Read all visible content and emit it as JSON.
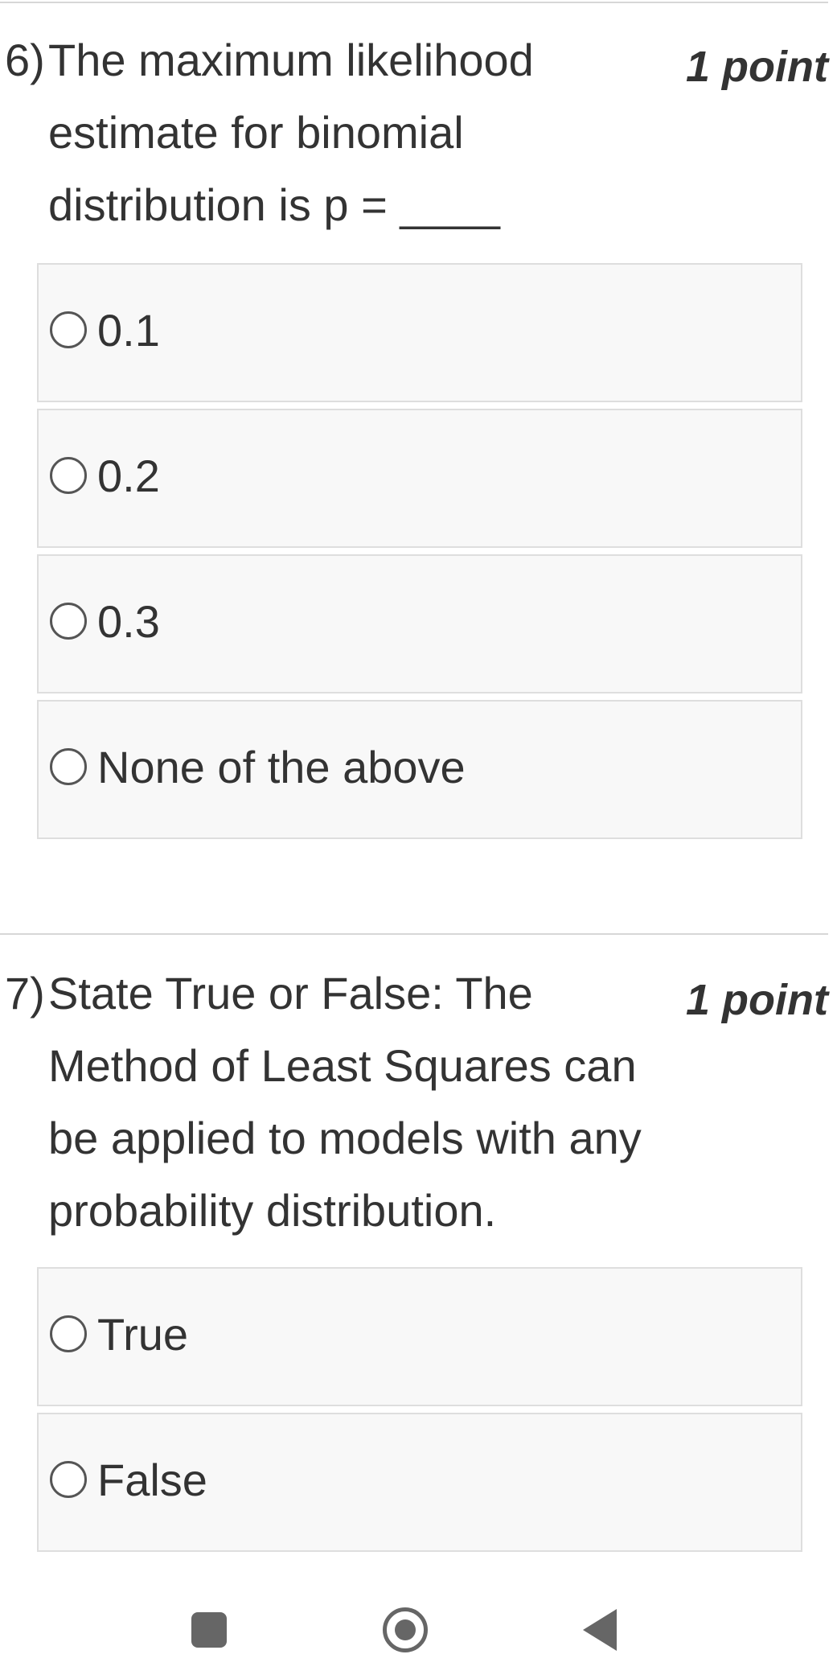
{
  "questions": [
    {
      "number": "6)",
      "text_lines": [
        "The maximum likelihood",
        "estimate for binomial",
        "distribution is p = ____"
      ],
      "points": "1 point",
      "options": [
        "0.1",
        "0.2",
        "0.3",
        "None of the above"
      ]
    },
    {
      "number": "7)",
      "text_lines": [
        "State True or False: The",
        "Method of Least Squares can",
        "be applied to models with any",
        "probability distribution."
      ],
      "points": "1 point",
      "options": [
        "True",
        "False"
      ]
    }
  ],
  "nav": {
    "recents_icon": "square-icon",
    "home_icon": "home-circle-icon",
    "back_icon": "triangle-back-icon"
  },
  "colors": {
    "text": "#333333",
    "option_bg": "#f8f8f8",
    "option_border": "#dedede",
    "divider": "#d7d7d7",
    "nav_icon": "#666666"
  }
}
